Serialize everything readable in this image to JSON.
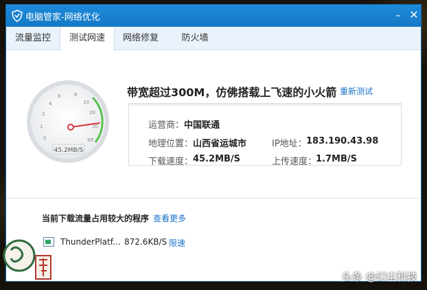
{
  "window": {
    "title": "电脑管家-网络优化"
  },
  "tabs": [
    {
      "label": "流量监控",
      "active": false
    },
    {
      "label": "测试网速",
      "active": true
    },
    {
      "label": "网络修复",
      "active": false
    },
    {
      "label": "防火墙",
      "active": false
    }
  ],
  "gauge": {
    "ticks": [
      "0",
      "1",
      "2",
      "4",
      "6",
      "8",
      "10",
      "20",
      "30",
      "99"
    ],
    "readout": "45.2MB/S"
  },
  "result": {
    "headline": "带宽超过300M，仿佛搭载上飞速的小火箭",
    "retest_label": "重新测试"
  },
  "info": {
    "isp_label": "运营商：",
    "isp_value": "中国联通",
    "location_label": "地理位置：",
    "location_value": "山西省运城市",
    "ip_label": "IP地址：",
    "ip_value": "183.190.43.98",
    "download_label": "下载速度：",
    "download_value": "45.2MB/S",
    "upload_label": "上传速度：",
    "upload_value": "1.7MB/S"
  },
  "programs": {
    "title": "当前下载流量占用较大的程序",
    "more_label": "查看更多",
    "items": [
      {
        "name": "ThunderPlatf...",
        "speed": "872.6KB/S",
        "action": "限速"
      }
    ]
  },
  "watermark": "头条 @幻尘科技",
  "colors": {
    "titlebar": "#1479c6",
    "link": "#1a73c8",
    "accent_green": "#2fa866",
    "needle": "#d9363e"
  },
  "icons": [
    "shield-icon",
    "minimize-icon",
    "close-icon",
    "program-icon"
  ]
}
